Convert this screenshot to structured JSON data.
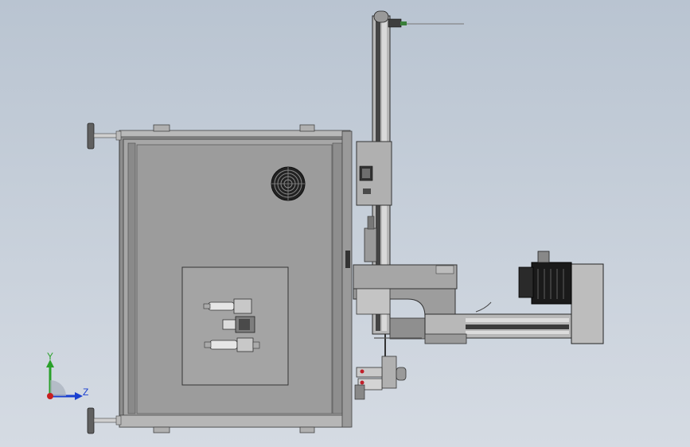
{
  "viewport": {
    "background_top": "#b9c4d1",
    "background_bottom": "#d5dbe3"
  },
  "model": {
    "colors": {
      "cabinet": "#9a9a9a",
      "cabinet_panel": "#a6a6a6",
      "frame_dark": "#5a5a5a",
      "motor_black": "#1e1e1e",
      "red_accent": "#c0202a"
    }
  },
  "triad": {
    "y_label": "Y",
    "z_label": "Z",
    "colors": {
      "y": "#2aa02a",
      "z": "#1a3fd0",
      "origin": "#c81e1e"
    }
  }
}
